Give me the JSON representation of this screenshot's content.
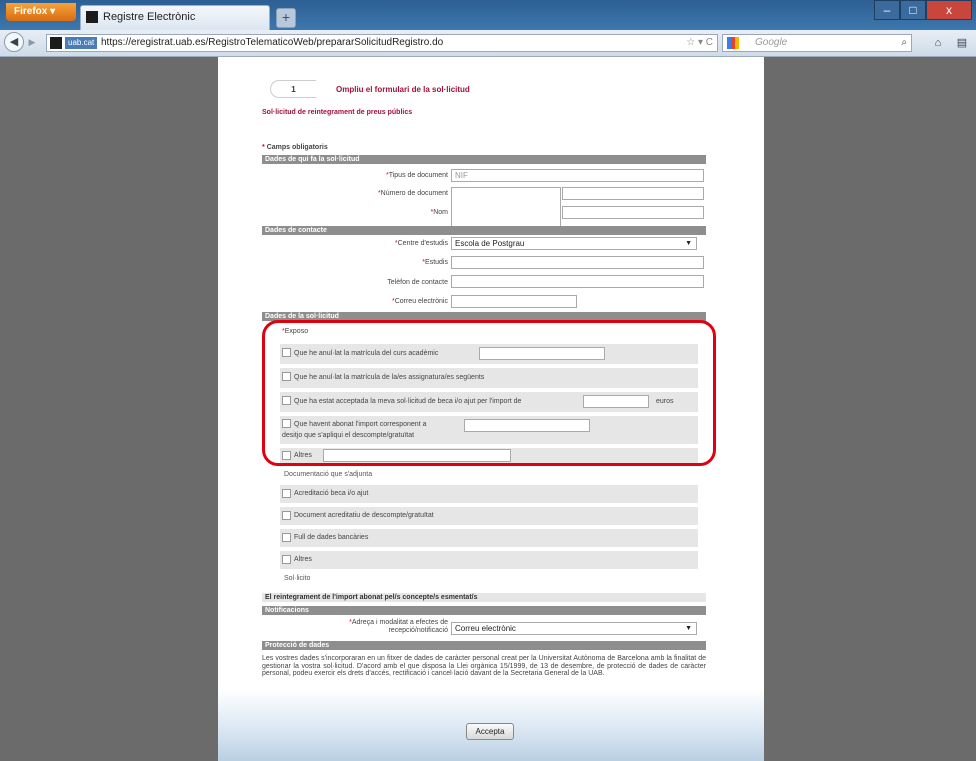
{
  "browser": {
    "firefox_button": "Firefox",
    "tab_title": "Registre Electrònic",
    "new_tab": "+",
    "window_controls": [
      "–",
      "□",
      "x"
    ],
    "domain_badge": "uab.cat",
    "url": "https://eregistrat.uab.es/RegistroTelematicoWeb/prepararSolicitudRegistro.do",
    "url_icons": "☆ ▾  C",
    "search_placeholder": "Google"
  },
  "form": {
    "step_number": "1",
    "step_title": "Ompliu el formulari de la sol·licitud",
    "subtitle": "Sol·licitud de reintegrament de preus públics",
    "required_note_star": "*",
    "required_note": "Camps obligatoris",
    "sections": {
      "requester": "Dades de qui fa la sol·licitud",
      "contact": "Dades de contacte",
      "request": "Dades de la sol·licitud",
      "notifications": "Notificacions",
      "privacy": "Protecció de dades"
    },
    "requester": {
      "doc_type_label": "Tipus de document",
      "doc_type_value": "NIF",
      "doc_number_label": "Número de document",
      "name_label": "Nom"
    },
    "contact": {
      "center_label": "Centre d'estudis",
      "center_value": "Escola de Postgrau",
      "studies_label": "Estudis",
      "phone_label": "Telèfon de contacte",
      "email_label": "Correu electrònic"
    },
    "request": {
      "expose_label": "Exposo",
      "options": [
        "Que he anul·lat la matrícula del curs acadèmic",
        "Que he anul·lat la matrícula de la/es assignatura/es següents",
        "Que ha estat acceptada la meva sol·licitud de beca i/o ajut per l'import de",
        "Que havent abonat l'import corresponent a",
        "desitjo que s'apliqui el descompte/gratuïtat",
        "Altres"
      ],
      "euros_label": "euros",
      "docs_title": "Documentació que s'adjunta",
      "docs": [
        "Acreditació beca i/o ajut",
        "Document acreditatiu de descompte/gratuïtat",
        "Full de dades bancàries",
        "Altres"
      ],
      "request_title": "Sol·licito",
      "request_text": "El reintegrament de l'import abonat pel/s concepte/s esmentat/s"
    },
    "notifications": {
      "label_line1": "Adreça i modalitat a efectes de",
      "label_line2": "recepció/notificació",
      "value": "Correu electrònic"
    },
    "privacy_text": "Les vostres dades s'incorporaran en un fitxer de dades de caràcter personal creat per la Universitat Autònoma de Barcelona amb la finalitat de gestionar la vostra sol·licitud. D'acord amb el que disposa la Llei orgànica 15/1999, de 13 de desembre, de protecció de dades de caràcter personal, podeu exercir els drets d'accés, rectificació i cancel·lació davant de la Secretaria General de la UAB.",
    "accept_button": "Accepta"
  }
}
